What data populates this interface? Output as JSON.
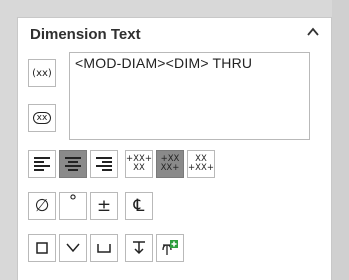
{
  "panel": {
    "title": "Dimension Text",
    "collapse_icon": "chevron-up-icon",
    "text_value": "<MOD-DIAM><DIM> THRU"
  },
  "paren_buttons": {
    "add_parentheses_label": "(xx)",
    "inspection_label": "xx"
  },
  "alignment": {
    "selected": "center",
    "justify": [
      "left",
      "center",
      "right"
    ],
    "vertical": [
      "top",
      "middle",
      "bottom"
    ],
    "vertical_selected": "middle"
  },
  "tolerance_stack": {
    "top": {
      "line1": "+XX+",
      "line2": "XX"
    },
    "middle": {
      "line1": "+XX",
      "line2": "XX+"
    },
    "bottom": {
      "line1": "XX",
      "line2": "+XX+"
    }
  },
  "symbols_row1": {
    "diameter": "∅",
    "degree": "°",
    "plus_minus": "±",
    "centerline": "℄"
  },
  "colors": {
    "active_button": "#8a8a8a",
    "border": "#b9b9b9",
    "title": "#303030"
  }
}
